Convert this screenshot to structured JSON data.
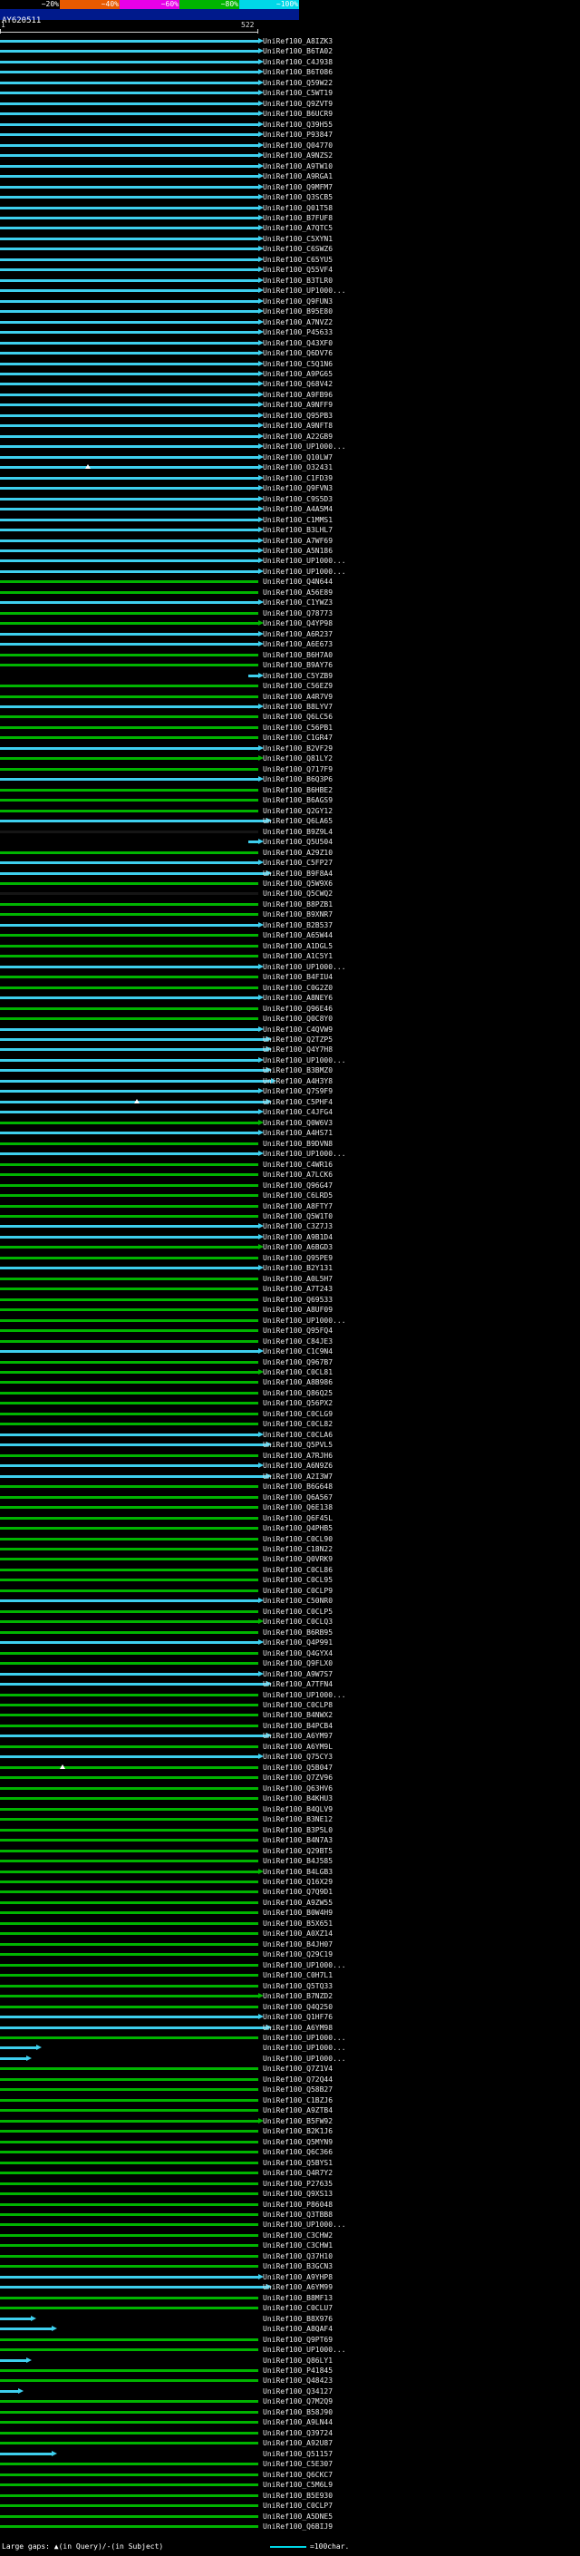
{
  "header": {
    "title": "AY620511"
  },
  "scale": {
    "bins": [
      {
        "label": "~20%",
        "color": "#000000"
      },
      {
        "label": "~40%",
        "color": "#e85a00"
      },
      {
        "label": "~60%",
        "color": "#e800e8"
      },
      {
        "label": "~80%",
        "color": "#00b400"
      },
      {
        "label": "~100%",
        "color": "#00d8e8"
      }
    ]
  },
  "ruler": {
    "start": "1",
    "end": "522"
  },
  "legend": {
    "gaps": "Large gaps: ▲(in Query)/-(in Subject)",
    "scale_label": "=100char.",
    "scale_line_color": "#00d8e8"
  },
  "colors": {
    "cyan": "#3ecfee",
    "green": "#00b400",
    "black": "#151515",
    "label": "#e8e8e8"
  },
  "query_length": 522,
  "rows": {
    "prefix": "UniRef100_",
    "items": [
      [
        "A8IZK3",
        "c",
        1,
        1
      ],
      [
        "B6TA02",
        "c",
        1,
        1
      ],
      [
        "C4J938",
        "c",
        1,
        1
      ],
      [
        "B6T086",
        "c",
        1,
        1
      ],
      [
        "Q59W22",
        "c",
        1,
        1
      ],
      [
        "C5WT19",
        "c",
        1,
        1
      ],
      [
        "Q9ZVT9",
        "c",
        1,
        1
      ],
      [
        "B6UCR9",
        "c",
        1,
        1
      ],
      [
        "Q39H55",
        "c",
        1,
        1
      ],
      [
        "P93847",
        "c",
        1,
        1
      ],
      [
        "Q04770",
        "c",
        1,
        1
      ],
      [
        "A9NZS2",
        "c",
        1,
        1
      ],
      [
        "A9TW10",
        "c",
        1,
        1
      ],
      [
        "A9RGA1",
        "c",
        1,
        1
      ],
      [
        "Q9MFM7",
        "c",
        1,
        1
      ],
      [
        "Q3SCB5",
        "c",
        1,
        1
      ],
      [
        "Q01T58",
        "c",
        1,
        1
      ],
      [
        "B7FUF8",
        "c",
        1,
        1
      ],
      [
        "A7QTC5",
        "c",
        1,
        1
      ],
      [
        "C5XYN1",
        "c",
        1,
        1
      ],
      [
        "C6SWZ6",
        "c",
        1,
        1
      ],
      [
        "C65YU5",
        "c",
        1,
        1
      ],
      [
        "Q55VF4",
        "c",
        1,
        1
      ],
      [
        "B3TLR0",
        "c",
        1,
        1
      ],
      [
        "UP1000...",
        "c",
        1,
        1
      ],
      [
        "Q9FUN3",
        "c",
        1,
        1
      ],
      [
        "B95E80",
        "c",
        1,
        1
      ],
      [
        "A7NVZ2",
        "c",
        1,
        1
      ],
      [
        "P45633",
        "c",
        1,
        1
      ],
      [
        "Q43XF0",
        "c",
        1,
        1
      ],
      [
        "Q6DV76",
        "c",
        1,
        1
      ],
      [
        "C5Q1N6",
        "c",
        1,
        1
      ],
      [
        "A9PG65",
        "c",
        1,
        1
      ],
      [
        "Q68V42",
        "c",
        1,
        1
      ],
      [
        "A9FB96",
        "c",
        1,
        1
      ],
      [
        "A9NFF9",
        "c",
        1,
        1
      ],
      [
        "Q95PB3",
        "c",
        1,
        1
      ],
      [
        "A9NFT8",
        "c",
        1,
        1
      ],
      [
        "A22GB9",
        "c",
        1,
        1
      ],
      [
        "UP1000...",
        "c",
        1,
        1
      ],
      [
        "Q10LW7",
        "c",
        1,
        1
      ],
      [
        "O32431",
        "c",
        1,
        1,
        0,
        [
          0.33
        ]
      ],
      [
        "C1FD39",
        "c",
        1,
        1
      ],
      [
        "Q9FVN3",
        "c",
        1,
        1
      ],
      [
        "C9S5D3",
        "c",
        1,
        1
      ],
      [
        "A4A5M4",
        "c",
        1,
        1
      ],
      [
        "C1MMS1",
        "c",
        1,
        1
      ],
      [
        "B3LHL7",
        "c",
        1,
        1
      ],
      [
        "A7WF69",
        "c",
        1,
        1
      ],
      [
        "A5N186",
        "c",
        1,
        1
      ],
      [
        "UP1000...",
        "c",
        1,
        1
      ],
      [
        "UP1000...",
        "c",
        1,
        1
      ],
      [
        "Q4N644",
        "g",
        1,
        0
      ],
      [
        "A56E89",
        "g",
        1,
        0
      ],
      [
        "C1YWZ3",
        "c",
        1,
        1
      ],
      [
        "Q78773",
        "g",
        1,
        0
      ],
      [
        "Q4YP98",
        "g",
        1,
        1
      ],
      [
        "A6R237",
        "c",
        1,
        1
      ],
      [
        "A6E673",
        "c",
        1,
        1
      ],
      [
        "B6H7A0",
        "g",
        1,
        0
      ],
      [
        "B9AY76",
        "g",
        1,
        0
      ],
      [
        "C5YZB9",
        "c",
        0.04,
        1,
        0.96
      ],
      [
        "C56EZ9",
        "g",
        1,
        0
      ],
      [
        "A4R7V9",
        "g",
        1,
        0
      ],
      [
        "B8LYV7",
        "c",
        1,
        1
      ],
      [
        "Q6LC56",
        "g",
        1,
        0
      ],
      [
        "C56PB1",
        "g",
        1,
        0
      ],
      [
        "C1GR47",
        "g",
        1,
        0
      ],
      [
        "B2VF29",
        "c",
        1,
        1
      ],
      [
        "Q81LY2",
        "g",
        1,
        1
      ],
      [
        "Q717F9",
        "g",
        1,
        0
      ],
      [
        "B6Q3P6",
        "c",
        1,
        1
      ],
      [
        "B6HBE2",
        "g",
        1,
        0
      ],
      [
        "B6AGS9",
        "g",
        1,
        0
      ],
      [
        "Q2GY12",
        "g",
        1,
        0
      ],
      [
        "Q6LA65",
        "c",
        1.03,
        1
      ],
      [
        "B9Z9L4",
        "k",
        1,
        0
      ],
      [
        "Q5U504",
        "c",
        0.04,
        1,
        0.96
      ],
      [
        "A29Z10",
        "g",
        1,
        0
      ],
      [
        "C5FP27",
        "c",
        1,
        1
      ],
      [
        "B9F8A4",
        "c",
        1.03,
        1
      ],
      [
        "Q5W9X6",
        "g",
        1,
        0
      ],
      [
        "Q5CWQ2",
        "k",
        1,
        0
      ],
      [
        "B8PZB1",
        "g",
        1,
        0
      ],
      [
        "B9XNR7",
        "g",
        1,
        0
      ],
      [
        "B2B537",
        "c",
        1,
        1
      ],
      [
        "A65W44",
        "g",
        1,
        0
      ],
      [
        "A1DGL5",
        "g",
        1,
        0
      ],
      [
        "A1C5Y1",
        "g",
        1,
        0
      ],
      [
        "UP1000...",
        "c",
        1,
        1
      ],
      [
        "B4FIU4",
        "g",
        1,
        0
      ],
      [
        "C0G2Z0",
        "g",
        1,
        0
      ],
      [
        "A8NEY6",
        "c",
        1,
        1
      ],
      [
        "Q96E46",
        "g",
        1,
        0
      ],
      [
        "Q0C8Y0",
        "g",
        1,
        0
      ],
      [
        "C4QVW9",
        "c",
        1,
        1
      ],
      [
        "Q2TZP5",
        "c",
        1.03,
        1
      ],
      [
        "Q4Y7H8",
        "c",
        1.03,
        1
      ],
      [
        "UP1000...",
        "c",
        1,
        1
      ],
      [
        "B3BMZ0",
        "c",
        1.03,
        1
      ],
      [
        "A4H3Y8",
        "c",
        1.05,
        1
      ],
      [
        "Q7S9F9",
        "c",
        1,
        1
      ],
      [
        "C5PHF4",
        "c",
        1.03,
        1,
        0,
        [
          0.52
        ]
      ],
      [
        "C4JFG4",
        "c",
        1,
        1
      ],
      [
        "Q0W6V3",
        "g",
        1,
        1
      ],
      [
        "A4HS71",
        "c",
        1,
        1
      ],
      [
        "B9DVN8",
        "g",
        1,
        0
      ],
      [
        "UP1000...",
        "c",
        1,
        1
      ],
      [
        "C4WR16",
        "g",
        1,
        0
      ],
      [
        "A7LCK6",
        "g",
        1,
        0
      ],
      [
        "Q96G47",
        "g",
        1,
        0
      ],
      [
        "C6LRD5",
        "g",
        1,
        0
      ],
      [
        "A8FTY7",
        "g",
        1,
        0
      ],
      [
        "Q5W1T0",
        "g",
        1,
        0
      ],
      [
        "C3Z7J3",
        "c",
        1,
        1
      ],
      [
        "A9B1D4",
        "c",
        1,
        1
      ],
      [
        "A6BGD3",
        "g",
        1,
        1
      ],
      [
        "Q95PE9",
        "g",
        1,
        0
      ],
      [
        "B2Y131",
        "c",
        1,
        1
      ],
      [
        "A0L5H7",
        "g",
        1,
        0
      ],
      [
        "A7T243",
        "g",
        1,
        0
      ],
      [
        "Q69533",
        "g",
        1,
        0
      ],
      [
        "A8UF09",
        "g",
        1,
        0
      ],
      [
        "UP1000...",
        "g",
        1,
        0
      ],
      [
        "Q95FQ4",
        "g",
        1,
        0
      ],
      [
        "C84JE3",
        "g",
        1,
        0
      ],
      [
        "C1C9N4",
        "c",
        1,
        1
      ],
      [
        "Q967B7",
        "g",
        1,
        0
      ],
      [
        "C0CL81",
        "g",
        1,
        1
      ],
      [
        "A8B986",
        "g",
        1,
        0
      ],
      [
        "Q86Q25",
        "g",
        1,
        0
      ],
      [
        "Q56PX2",
        "g",
        1,
        0
      ],
      [
        "C0CLG9",
        "g",
        1,
        0
      ],
      [
        "C0CL82",
        "g",
        1,
        0
      ],
      [
        "C0CLA6",
        "c",
        1,
        1
      ],
      [
        "Q5PVL5",
        "c",
        1.03,
        1
      ],
      [
        "A7RJH6",
        "g",
        1,
        0
      ],
      [
        "A6N9Z6",
        "c",
        1,
        1
      ],
      [
        "A2I3W7",
        "c",
        1.03,
        1
      ],
      [
        "B6G648",
        "g",
        1,
        0
      ],
      [
        "Q6A567",
        "g",
        1,
        0
      ],
      [
        "Q6E138",
        "g",
        1,
        0
      ],
      [
        "Q6F45L",
        "g",
        1,
        0
      ],
      [
        "Q4PHB5",
        "g",
        1,
        0
      ],
      [
        "C0CL90",
        "g",
        1,
        0
      ],
      [
        "C18N22",
        "g",
        1,
        0
      ],
      [
        "Q0VRK9",
        "g",
        1,
        0
      ],
      [
        "C0CL86",
        "g",
        1,
        0
      ],
      [
        "C0CL95",
        "g",
        1,
        0
      ],
      [
        "C0CLP9",
        "g",
        1,
        0
      ],
      [
        "C50NR0",
        "c",
        1,
        1
      ],
      [
        "C0CLP5",
        "g",
        1,
        0
      ],
      [
        "C0CLQ3",
        "g",
        1,
        1
      ],
      [
        "B6RB95",
        "g",
        1,
        0
      ],
      [
        "Q4P991",
        "c",
        1,
        1
      ],
      [
        "Q4GYX4",
        "g",
        1,
        0
      ],
      [
        "Q9FLX0",
        "g",
        1,
        0
      ],
      [
        "A9W7S7",
        "c",
        1,
        1
      ],
      [
        "A7TFN4",
        "c",
        1.03,
        1
      ],
      [
        "UP1000...",
        "g",
        1,
        0
      ],
      [
        "C0CLP8",
        "g",
        1,
        0
      ],
      [
        "B4NWX2",
        "g",
        1,
        0
      ],
      [
        "B4PCB4",
        "g",
        1,
        0
      ],
      [
        "A6YM97",
        "c",
        1.03,
        1
      ],
      [
        "A6YM9L",
        "g",
        1,
        0
      ],
      [
        "Q75CY3",
        "c",
        1,
        1
      ],
      [
        "Q5B047",
        "g",
        1,
        0,
        0,
        [
          0.23
        ]
      ],
      [
        "Q7ZV96",
        "g",
        1,
        0
      ],
      [
        "Q63HV6",
        "g",
        1,
        0
      ],
      [
        "B4KHU3",
        "g",
        1,
        0
      ],
      [
        "B4QLV9",
        "g",
        1,
        0
      ],
      [
        "B3NE12",
        "g",
        1,
        0
      ],
      [
        "B3P5L0",
        "g",
        1,
        0
      ],
      [
        "B4N7A3",
        "g",
        1,
        0
      ],
      [
        "Q29BT5",
        "g",
        1,
        0
      ],
      [
        "B4J585",
        "g",
        1,
        0
      ],
      [
        "B4LGB3",
        "g",
        1,
        1
      ],
      [
        "Q16X29",
        "g",
        1,
        0
      ],
      [
        "Q7Q9D1",
        "g",
        1,
        0
      ],
      [
        "A9ZW55",
        "g",
        1,
        0
      ],
      [
        "B0W4H9",
        "g",
        1,
        0
      ],
      [
        "B5X651",
        "g",
        1,
        0
      ],
      [
        "A0XZ14",
        "g",
        1,
        0
      ],
      [
        "B4JH07",
        "g",
        1,
        0
      ],
      [
        "Q29C19",
        "g",
        1,
        0
      ],
      [
        "UP1000...",
        "g",
        1,
        0
      ],
      [
        "C0H7L1",
        "g",
        1,
        0
      ],
      [
        "Q5TQ33",
        "g",
        1,
        0
      ],
      [
        "B7NZD2",
        "g",
        1,
        1
      ],
      [
        "Q4Q250",
        "g",
        1,
        0
      ],
      [
        "Q1HF76",
        "c",
        1,
        1
      ],
      [
        "A6YM98",
        "c",
        1.03,
        1
      ],
      [
        "UP1000...",
        "g",
        1,
        0
      ],
      [
        "UP1000...",
        "c",
        0.14,
        1
      ],
      [
        "UP1000...",
        "c",
        0.1,
        1
      ],
      [
        "Q7Z1V4",
        "g",
        1,
        0
      ],
      [
        "Q72Q44",
        "g",
        1,
        0
      ],
      [
        "Q58B27",
        "g",
        1,
        0
      ],
      [
        "C1BZJ6",
        "g",
        1,
        0
      ],
      [
        "A9ZTB4",
        "g",
        1,
        0
      ],
      [
        "B5FW92",
        "g",
        1,
        1
      ],
      [
        "B2K1J6",
        "g",
        1,
        0
      ],
      [
        "Q5MYN9",
        "g",
        1,
        0
      ],
      [
        "Q6C366",
        "g",
        1,
        0
      ],
      [
        "Q5BYS1",
        "g",
        1,
        0
      ],
      [
        "Q4R7Y2",
        "g",
        1,
        0
      ],
      [
        "P27635",
        "g",
        1,
        0
      ],
      [
        "Q9XS13",
        "g",
        1,
        0
      ],
      [
        "P86048",
        "g",
        1,
        0
      ],
      [
        "Q3TBB8",
        "g",
        1,
        0
      ],
      [
        "UP1000...",
        "g",
        1,
        0
      ],
      [
        "C3CHW2",
        "g",
        1,
        0
      ],
      [
        "C3CHW1",
        "g",
        1,
        0
      ],
      [
        "Q37H10",
        "g",
        1,
        0
      ],
      [
        "B3GCN3",
        "g",
        1,
        0
      ],
      [
        "A9YHP8",
        "c",
        1,
        1
      ],
      [
        "A6YM99",
        "c",
        1.03,
        1
      ],
      [
        "B8MF13",
        "g",
        1,
        0
      ],
      [
        "C0CLU7",
        "g",
        1,
        0
      ],
      [
        "B8X976",
        "c",
        0.12,
        1
      ],
      [
        "A8QAF4",
        "c",
        0.2,
        1
      ],
      [
        "Q9PT69",
        "g",
        1,
        0
      ],
      [
        "UP1000...",
        "g",
        1,
        0
      ],
      [
        "Q86LY1",
        "c",
        0.1,
        1
      ],
      [
        "P41845",
        "g",
        1,
        0
      ],
      [
        "Q48423",
        "g",
        1,
        0
      ],
      [
        "Q34127",
        "c",
        0.07,
        1
      ],
      [
        "Q7M2Q9",
        "g",
        1,
        0
      ],
      [
        "B58J90",
        "g",
        1,
        0
      ],
      [
        "A9LN44",
        "g",
        1,
        0
      ],
      [
        "Q39724",
        "g",
        1,
        0
      ],
      [
        "A92U87",
        "g",
        1,
        0
      ],
      [
        "Q51157",
        "c",
        0.2,
        1
      ],
      [
        "C5E307",
        "g",
        1,
        0
      ],
      [
        "Q6CKC7",
        "g",
        1,
        0
      ],
      [
        "C5M6L9",
        "g",
        1,
        0
      ],
      [
        "B5E930",
        "g",
        1,
        0
      ],
      [
        "C0CLP7",
        "g",
        1,
        0
      ],
      [
        "A5DNE5",
        "g",
        1,
        0
      ],
      [
        "Q6BIJ9",
        "g",
        1,
        0
      ]
    ]
  }
}
